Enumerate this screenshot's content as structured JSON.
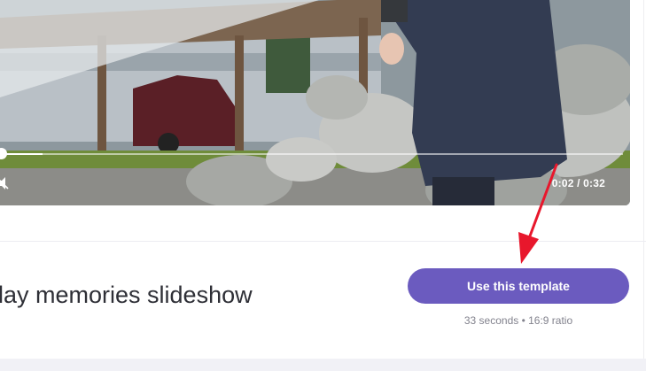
{
  "video": {
    "time": "0:02 / 0:32",
    "progress": 0.0625
  },
  "template": {
    "title": "lay memories slideshow",
    "cta_label": "Use this template",
    "meta": "33 seconds • 16:9 ratio"
  },
  "colors": {
    "accent": "#6b5bbf",
    "annotation_arrow": "#e8172c"
  },
  "icons": {
    "volume": "speaker-muted-icon"
  }
}
